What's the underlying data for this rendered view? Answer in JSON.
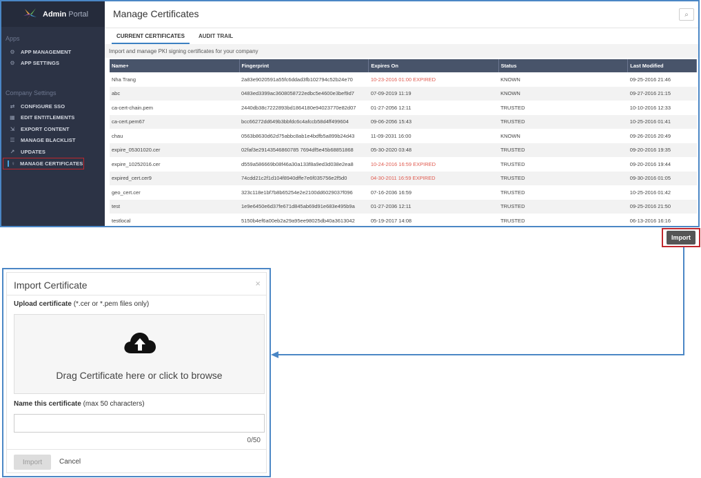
{
  "brand": {
    "bold": "Admin",
    "light": "Portal"
  },
  "sidebar": {
    "apps_title": "Apps",
    "apps": [
      {
        "label": "APP MANAGEMENT",
        "icon": "gear-icon"
      },
      {
        "label": "APP SETTINGS",
        "icon": "gears-icon"
      }
    ],
    "company_title": "Company Settings",
    "company": [
      {
        "label": "CONFIGURE SSO",
        "icon": "arrows-icon"
      },
      {
        "label": "EDIT ENTITLEMENTS",
        "icon": "grid-icon"
      },
      {
        "label": "EXPORT CONTENT",
        "icon": "export-icon"
      },
      {
        "label": "MANAGE BLACKLIST",
        "icon": "list-icon"
      },
      {
        "label": "UPDATES",
        "icon": "chart-icon"
      },
      {
        "label": "MANAGE CERTIFICATES",
        "icon": "certificate-icon",
        "active": true
      }
    ]
  },
  "main": {
    "title": "Manage Certificates",
    "tabs": [
      "CURRENT CERTIFICATES",
      "AUDIT TRAIL"
    ],
    "subtitle": "Import and manage PKI signing certificates for your company",
    "columns": [
      "Name+",
      "Fingerprint",
      "Expires On",
      "Status",
      "Last Modified"
    ],
    "rows": [
      {
        "name": "Nha Trang",
        "fp": "2a83e9020591a55fc6ddad3fb102794c52b24e70",
        "exp": "10-23-2016 01:00 EXPIRED",
        "expired": true,
        "status": "KNOWN",
        "mod": "09-25-2016 21:46"
      },
      {
        "name": "abc",
        "fp": "0483ed3399ac3608058722edbc5e4600e3bef9d7",
        "exp": "07-09-2019 11:19",
        "expired": false,
        "status": "KNOWN",
        "mod": "09-27-2016 21:15"
      },
      {
        "name": "ca-cert-chain.pem",
        "fp": "2440db38c7222893bd1864180e94023770e82d07",
        "exp": "01-27-2056 12:11",
        "expired": false,
        "status": "TRUSTED",
        "mod": "10-10-2016 12:33"
      },
      {
        "name": "ca-cert.pem67",
        "fp": "bcc66272dd649b3bbfdc6c4afccb58d4ff499604",
        "exp": "09-06-2056 15:43",
        "expired": false,
        "status": "TRUSTED",
        "mod": "10-25-2016 01:41"
      },
      {
        "name": "chau",
        "fp": "0563b8630d62d75abbc8ab1e4bdfb5a899b24d43",
        "exp": "11-09-2031 16:00",
        "expired": false,
        "status": "KNOWN",
        "mod": "09-26-2016 20:49"
      },
      {
        "name": "expire_05301020.cer",
        "fp": "02faf3e29143546860785 7694df5e45b68851868",
        "exp": "05-30-2020 03:48",
        "expired": false,
        "status": "TRUSTED",
        "mod": "09-20-2016 19:35"
      },
      {
        "name": "expire_10252016.cer",
        "fp": "d559a586669b08f46a30a133f8a9ed3d038e2ea8",
        "exp": "10-24-2016 16:59 EXPIRED",
        "expired": true,
        "status": "TRUSTED",
        "mod": "09-20-2016 19:44"
      },
      {
        "name": "expired_cert.cer9",
        "fp": "74cdd21c2f1d104f8940dffe7e6f035756e2f5d0",
        "exp": "04-30-2011 16:59 EXPIRED",
        "expired": true,
        "status": "TRUSTED",
        "mod": "09-30-2016 01:05"
      },
      {
        "name": "geo_cert.cer",
        "fp": "323c118e1bf7b8b65254e2e2100dd6029037f096",
        "exp": "07-16-2036 16:59",
        "expired": false,
        "status": "TRUSTED",
        "mod": "10-25-2016 01:42"
      },
      {
        "name": "test",
        "fp": "1e9e6450e6d37fe671d845ab69d91e683e495b9a",
        "exp": "01-27-2036 12:11",
        "expired": false,
        "status": "TRUSTED",
        "mod": "09-25-2016 21:50"
      },
      {
        "name": "testlocal",
        "fp": "5150b4ef6a00eb2a29a95ee98025db40a3613042",
        "exp": "05-19-2017 14:08",
        "expired": false,
        "status": "TRUSTED",
        "mod": "06-13-2016 16:16"
      }
    ]
  },
  "import_button": "Import",
  "dialog": {
    "title": "Import Certificate",
    "close": "×",
    "upload_label_bold": "Upload certificate",
    "upload_label_rest": " (*.cer or *.pem files only)",
    "drop_text": "Drag Certificate here or click to browse",
    "name_label_bold": "Name this certificate",
    "name_label_rest": " (max 50 characters)",
    "name_value": "",
    "char_count": "0/50",
    "import_label": "Import",
    "cancel_label": "Cancel"
  },
  "colors": {
    "accent": "#4a86c5",
    "sidebar": "#2c3345",
    "table_header": "#48546a",
    "expired": "#e05a4f",
    "highlight": "#c0272d"
  }
}
